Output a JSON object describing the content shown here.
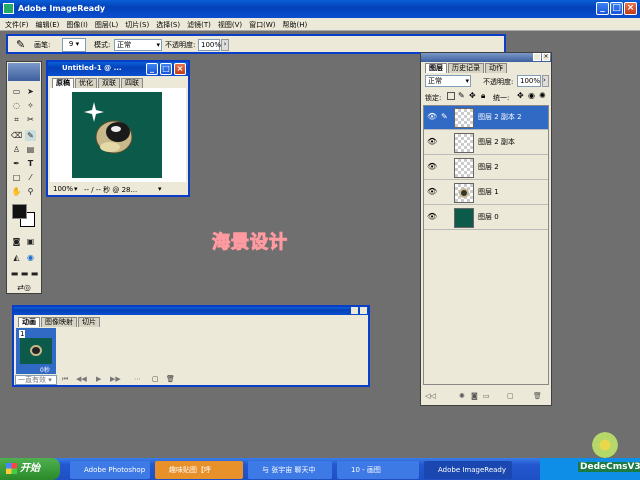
{
  "app": {
    "title": "Adobe ImageReady"
  },
  "menu": [
    "文件(F)",
    "编辑(E)",
    "图像(I)",
    "图层(L)",
    "切片(S)",
    "选择(S)",
    "滤镜(T)",
    "视图(V)",
    "窗口(W)",
    "帮助(H)"
  ],
  "options": {
    "brush_label": "画笔:",
    "brush_size": "9",
    "mode_label": "模式:",
    "mode_value": "正常",
    "opacity_label": "不透明度:",
    "opacity_value": "100%"
  },
  "doc": {
    "title": "Untitled-1 @ ...",
    "tabs": [
      "原稿",
      "优化",
      "双联",
      "四联"
    ],
    "status_zoom": "100%",
    "status_text": "-- / -- 秒 @ 28..."
  },
  "layers": {
    "tabs": [
      "图层",
      "历史记录",
      "动作"
    ],
    "mode": "正常",
    "opacity_label": "不透明度:",
    "opacity": "100%",
    "lock_label": "锁定:",
    "unify_label": "统一:",
    "items": [
      {
        "name": "图层 2 副本 2",
        "selected": true
      },
      {
        "name": "图层 2 副本",
        "selected": false
      },
      {
        "name": "图层 2",
        "selected": false
      },
      {
        "name": "图层 1",
        "selected": false
      },
      {
        "name": "图层 0",
        "selected": false
      }
    ]
  },
  "animation": {
    "tabs": [
      "动画",
      "图像映射",
      "切片"
    ],
    "frame_number": "1",
    "frame_delay": "0秒",
    "loop": "一直有效"
  },
  "watermark": "海景设计",
  "taskbar": {
    "start": "开始",
    "items": [
      "Adobe Photoshop",
      "趣味贴图【呼",
      "与 张宇宙 聊天中",
      "10 - 画图",
      "Adobe ImageReady"
    ],
    "brand": "DedeCmsV3"
  },
  "colors": {
    "title_bar": "#0a4fd0",
    "canvas": "#0c5a4a",
    "workspace": "#6f6f6f"
  }
}
